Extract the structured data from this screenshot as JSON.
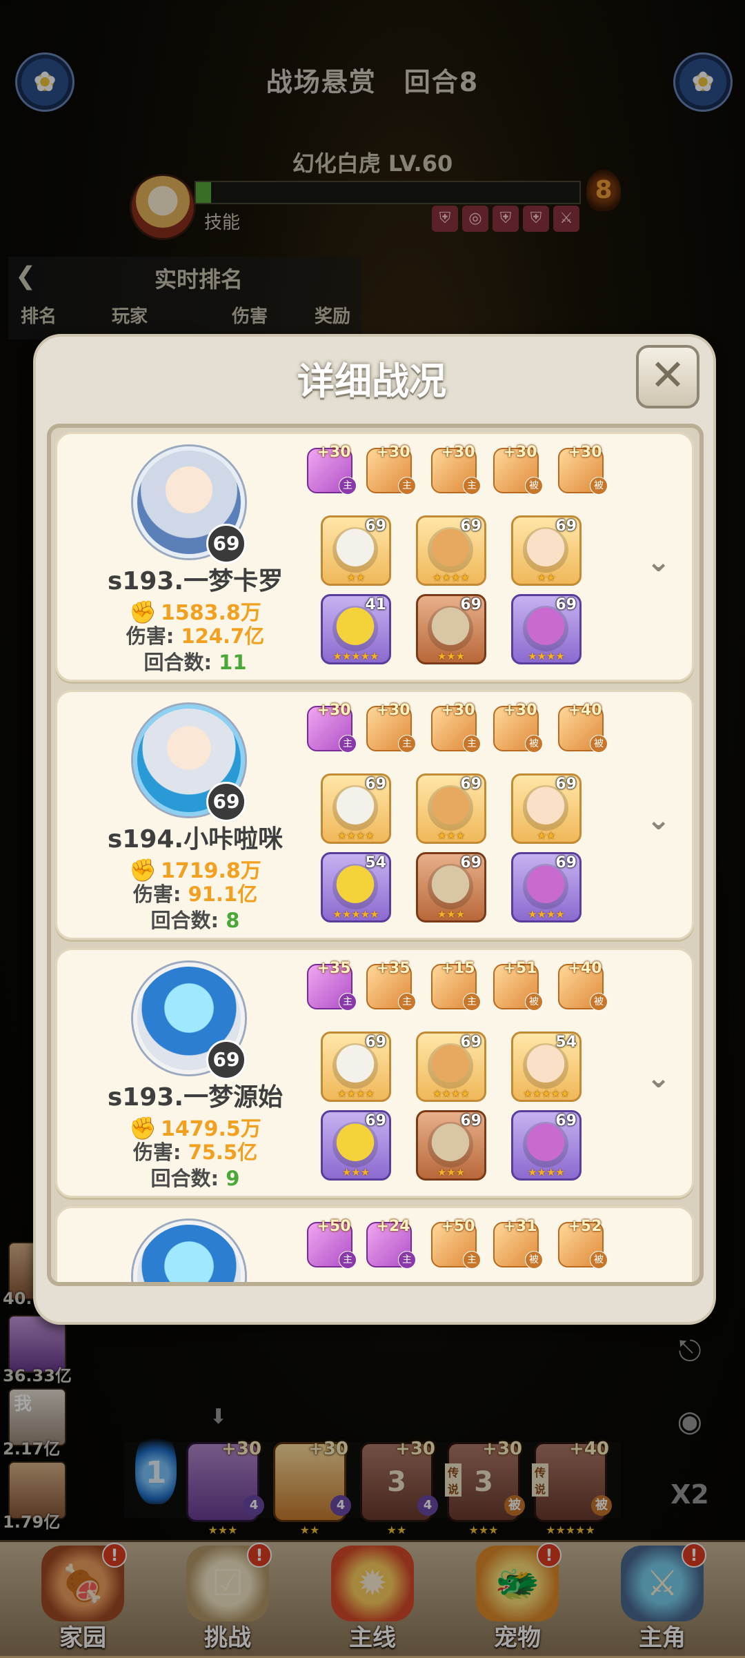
{
  "header": {
    "title": "战场悬赏",
    "round": "回合8"
  },
  "boss": {
    "name": "幻化白虎 LV.60",
    "skill_label": "技能",
    "fire_count": "8",
    "hp_fraction": 0.04
  },
  "ranking": {
    "title": "实时排名",
    "columns": [
      "排名",
      "玩家",
      "伤害",
      "奖励"
    ]
  },
  "side_list": [
    {
      "value": "40."
    },
    {
      "value": "36.33亿"
    },
    {
      "value": "2.17亿",
      "avatar_text": "我"
    },
    {
      "value": "1.79亿"
    }
  ],
  "right_buttons": [
    "exit-icon",
    "eye-icon",
    "x2-speed"
  ],
  "speed_label": "X2",
  "team": {
    "energy": "1",
    "cards": [
      {
        "lv": "+30",
        "tag": "4",
        "stars": "★★★"
      },
      {
        "lv": "+30",
        "tag": "4",
        "stars": "★★"
      },
      {
        "lv": "+30",
        "num": "3",
        "tag": "4",
        "stars": "★★"
      },
      {
        "lv": "+30",
        "num": "3",
        "tag": "被",
        "stars": "★★★",
        "side_tag": "传说"
      },
      {
        "lv": "+40",
        "tag": "被",
        "stars": "★★★★★",
        "side_tag": "传说"
      }
    ]
  },
  "nav": [
    {
      "label": "家园",
      "badge": "!"
    },
    {
      "label": "挑战",
      "badge": "!"
    },
    {
      "label": "主线",
      "badge": ""
    },
    {
      "label": "宠物",
      "badge": "!"
    },
    {
      "label": "主角",
      "badge": "!"
    }
  ],
  "modal": {
    "title": "详细战况",
    "close_label": "✕",
    "stats_labels": {
      "damage": "伤害:",
      "rounds": "回合数:"
    },
    "players": [
      {
        "name": "s193.一梦卡罗",
        "level": "69",
        "power": "1583.8万",
        "damage": "124.7亿",
        "rounds": "11",
        "equips": [
          {
            "lv": "+30",
            "tag": "主"
          },
          {
            "lv": "+30",
            "tag": "主"
          },
          {
            "lv": "+30",
            "tag": "主"
          },
          {
            "lv": "+30",
            "tag": "被"
          },
          {
            "lv": "+30",
            "tag": "被"
          }
        ],
        "pets": [
          {
            "lv": "69",
            "stars": "★★"
          },
          {
            "lv": "69",
            "stars": "★★★★"
          },
          {
            "lv": "69",
            "stars": "★★"
          },
          {
            "lv": "41",
            "stars": "★★★★★"
          },
          {
            "lv": "69",
            "stars": "★★★"
          },
          {
            "lv": "69",
            "stars": "★★★★"
          }
        ]
      },
      {
        "name": "s194.小咔啦咪",
        "level": "69",
        "power": "1719.8万",
        "damage": "91.1亿",
        "rounds": "8",
        "equips": [
          {
            "lv": "+30",
            "tag": "主"
          },
          {
            "lv": "+30",
            "tag": "主"
          },
          {
            "lv": "+30",
            "tag": "主"
          },
          {
            "lv": "+30",
            "tag": "被"
          },
          {
            "lv": "+40",
            "tag": "被"
          }
        ],
        "pets": [
          {
            "lv": "69",
            "stars": "★★★★"
          },
          {
            "lv": "69",
            "stars": "★★★"
          },
          {
            "lv": "69",
            "stars": "★★"
          },
          {
            "lv": "54",
            "stars": "★★★★★"
          },
          {
            "lv": "69",
            "stars": "★★★"
          },
          {
            "lv": "69",
            "stars": "★★★★"
          }
        ]
      },
      {
        "name": "s193.一梦源始",
        "level": "69",
        "power": "1479.5万",
        "damage": "75.5亿",
        "rounds": "9",
        "equips": [
          {
            "lv": "+35",
            "tag": "主"
          },
          {
            "lv": "+35",
            "tag": "主"
          },
          {
            "lv": "+15",
            "tag": "主"
          },
          {
            "lv": "+51",
            "tag": "被"
          },
          {
            "lv": "+40",
            "tag": "被"
          }
        ],
        "pets": [
          {
            "lv": "69",
            "stars": "★★★★"
          },
          {
            "lv": "69",
            "stars": "★★★★"
          },
          {
            "lv": "54",
            "stars": "★★★★★"
          },
          {
            "lv": "69",
            "stars": "★★★"
          },
          {
            "lv": "69",
            "stars": "★★★"
          },
          {
            "lv": "69",
            "stars": "★★★★"
          }
        ]
      },
      {
        "equips": [
          {
            "lv": "+50",
            "tag": "主"
          },
          {
            "lv": "+24",
            "tag": "主"
          },
          {
            "lv": "+50",
            "tag": "主"
          },
          {
            "lv": "+31",
            "tag": "被"
          },
          {
            "lv": "+52",
            "tag": "被"
          }
        ]
      }
    ]
  }
}
